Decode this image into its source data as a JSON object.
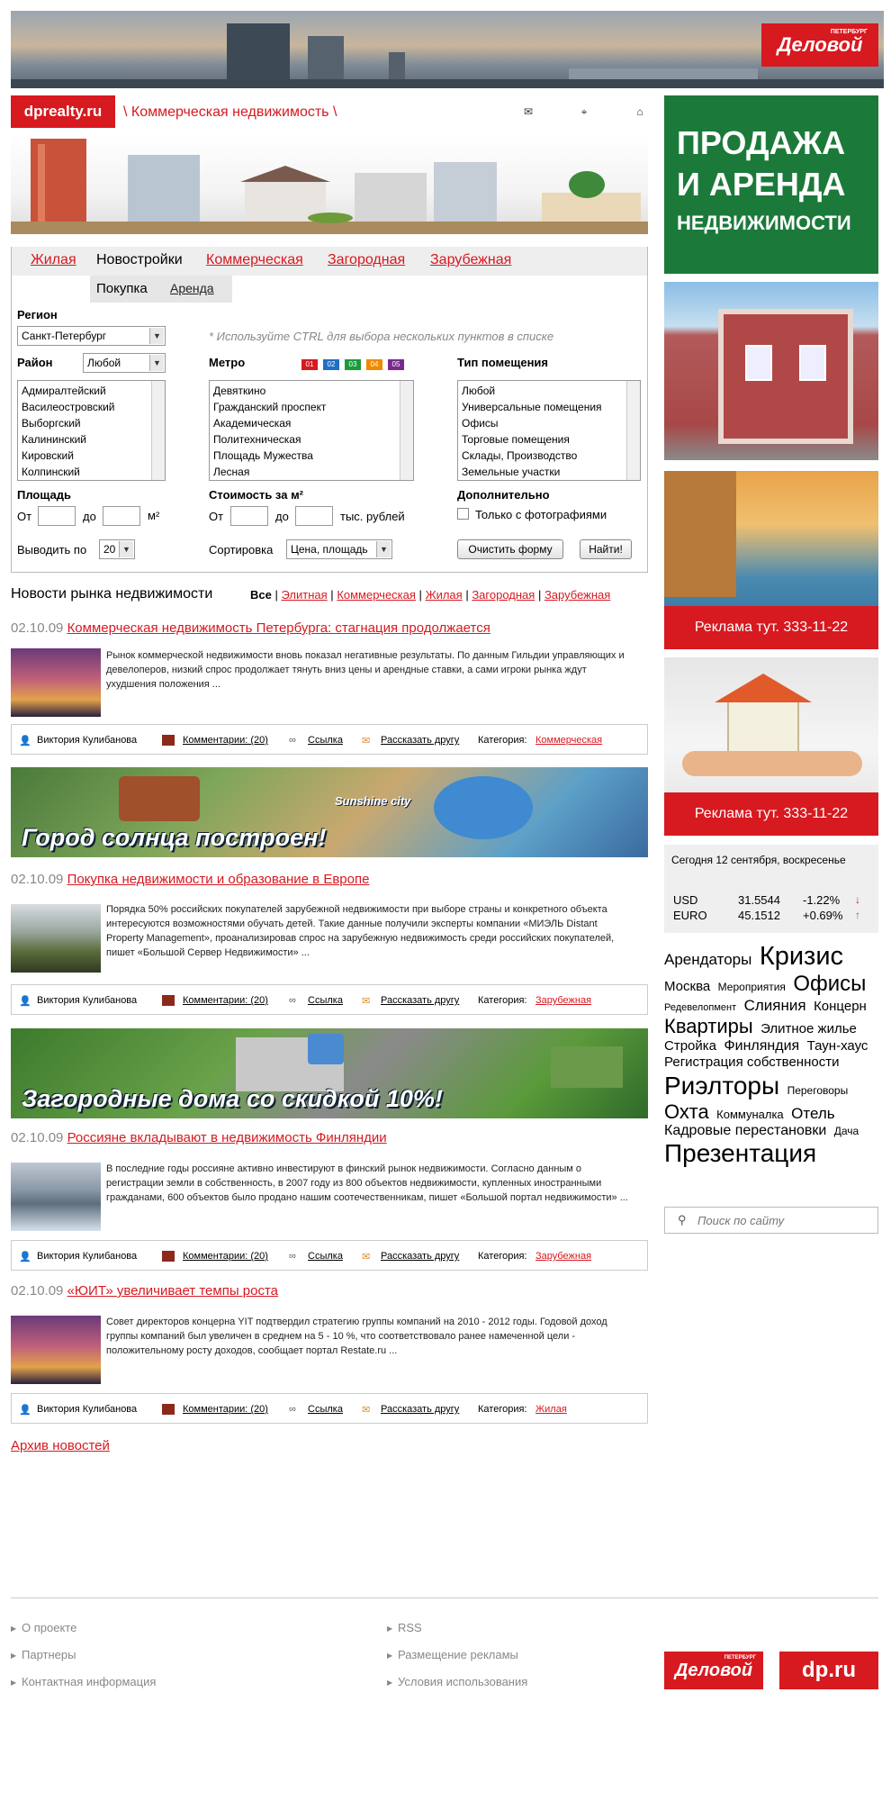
{
  "header": {
    "brand_top": "Деловой",
    "brand_top_small": "ПЕТЕРБУРГ",
    "site_logo": "dprealty.ru",
    "section_title": "\\ Коммерческая недвижимость \\",
    "icons": [
      "mail-icon",
      "sitemap-icon",
      "home-icon"
    ]
  },
  "tabs": [
    "Жилая",
    "Новостройки",
    "Коммерческая",
    "Загородная",
    "Зарубежная"
  ],
  "active_tab": "Новостройки",
  "subtabs": [
    "Покупка",
    "Аренда"
  ],
  "form": {
    "region_label": "Регион",
    "region_value": "Санкт-Петербург",
    "hint": "* Используйте CTRL для выбора нескольких пунктов в списке",
    "district_label": "Район",
    "district_value": "Любой",
    "districts": [
      "Адмиралтейский",
      "Василеостровский",
      "Выборгский",
      "Калининский",
      "Кировский",
      "Колпинский"
    ],
    "metro_label": "Метро",
    "metro_lines": [
      {
        "label": "01",
        "color": "#d71920"
      },
      {
        "label": "02",
        "color": "#1f6fc5"
      },
      {
        "label": "03",
        "color": "#1b9b3a"
      },
      {
        "label": "04",
        "color": "#f08a00"
      },
      {
        "label": "05",
        "color": "#7a2a8f"
      }
    ],
    "metro": [
      "Девяткино",
      "Гражданский проспект",
      "Академическая",
      "Политехническая",
      "Площадь Мужества",
      "Лесная"
    ],
    "type_label": "Тип помещения",
    "types": [
      "Любой",
      "Универсальные помещения",
      "Офисы",
      "Торговые помещения",
      "Склады, Производство",
      "Земельные участки"
    ],
    "area_label": "Площадь",
    "from": "От",
    "to": "до",
    "area_unit": "м²",
    "price_label": "Стоимость за м²",
    "price_unit": "тыс. рублей",
    "extra_label": "Дополнительно",
    "photos_only": "Только с фотографиями",
    "per_page_label": "Выводить по",
    "per_page_value": "20",
    "sort_label": "Сортировка",
    "sort_value": "Цена, площадь",
    "clear_btn": "Очистить форму",
    "search_btn": "Найти!"
  },
  "news_section": {
    "title": "Новости рынка недвижимости",
    "filters": [
      "Все",
      "Элитная",
      "Коммерческая",
      "Жилая",
      "Загородная",
      "Зарубежная"
    ],
    "archive": "Архив новостей"
  },
  "news": [
    {
      "date": "02.10.09",
      "title": "Коммерческая недвижимость Петербурга: стагнация продолжается",
      "text": "Рынок коммерческой недвижимости вновь показал негативные результаты. По данным Гильдии управляющих и девелоперов, низкий спрос продолжает тянуть вниз цены и арендные ставки, а сами игроки рынка ждут ухудшения положения ...",
      "author": "Виктория Кулибанова",
      "comments": "Комментарии: (20)",
      "link": "Ссылка",
      "share": "Рассказать другу",
      "cat_label": "Категория:",
      "category": "Коммерческая"
    },
    {
      "date": "02.10.09",
      "title": "Покупка недвижимости и образование в Европе",
      "text": "Порядка 50% российских покупателей зарубежной недвижимости при выборе страны и конкретного объекта интересуются возможностями обучать детей. Такие данные получили эксперты компании «МИЭЛЬ Distant Property Management», проанализировав спрос на зарубежную недвижимость среди российских покупателей, пишет «Большой Сервер Недвижимости» ...",
      "author": "Виктория Кулибанова",
      "comments": "Комментарии: (20)",
      "link": "Ссылка",
      "share": "Рассказать другу",
      "cat_label": "Категория:",
      "category": "Зарубежная"
    },
    {
      "date": "02.10.09",
      "title": "Россияне вкладывают в недвижимость Финляндии",
      "text": "В последние годы россияне активно инвестируют в финский рынок недвижимости. Согласно данным о регистрации земли в собственность, в 2007 году из 800 объектов недвижимости, купленных иностранными гражданами, 600 объектов было продано нашим соотечественникам, пишет «Большой портал недвижимости» ...",
      "author": "Виктория Кулибанова",
      "comments": "Комментарии: (20)",
      "link": "Ссылка",
      "share": "Рассказать другу",
      "cat_label": "Категория:",
      "category": "Зарубежная"
    },
    {
      "date": "02.10.09",
      "title": "«ЮИТ» увеличивает темпы роста",
      "text": "Совет директоров концерна YIT подтвердил стратегию группы компаний на 2010 - 2012 годы. Годовой доход группы компаний был увеличен в среднем на 5 - 10 %, что соответствовало ранее намеченной цели - положительному росту доходов, сообщает портал Restate.ru ...",
      "author": "Виктория Кулибанова",
      "comments": "Комментарии: (20)",
      "link": "Ссылка",
      "share": "Рассказать другу",
      "cat_label": "Категория:",
      "category": "Жилая"
    }
  ],
  "promos": [
    {
      "text": "Город солнца построен!",
      "logo": "Sunshine city"
    },
    {
      "text": "Загородные дома со скидкой 10%!"
    }
  ],
  "sidebar": {
    "ad_main": [
      "ПРОДАЖА",
      "И АРЕНДА",
      "НЕДВИЖИМОСТИ"
    ],
    "ad_phone": "Реклама тут. 333-11-22",
    "date_line": "Сегодня 12 сентября, воскресенье",
    "currencies": [
      {
        "name": "USD",
        "rate": "31.5544",
        "change": "-1.22%",
        "dir": "down"
      },
      {
        "name": "EURO",
        "rate": "45.1512",
        "change": "+0.69%",
        "dir": "up"
      }
    ],
    "tags": [
      {
        "t": "Арендаторы",
        "s": 17
      },
      {
        "t": "Кризис",
        "s": 29
      },
      {
        "t": "Москва",
        "s": 15
      },
      {
        "t": "Мероприятия",
        "s": 12
      },
      {
        "t": "Офисы",
        "s": 24
      },
      {
        "t": "Редевелопмент",
        "s": 11
      },
      {
        "t": "Слияния",
        "s": 17
      },
      {
        "t": "Концерн",
        "s": 15
      },
      {
        "t": "Квартиры",
        "s": 22
      },
      {
        "t": "Элитное жилье",
        "s": 15
      },
      {
        "t": "Стройка",
        "s": 15
      },
      {
        "t": "Финляндия",
        "s": 16
      },
      {
        "t": "Таун-хаус",
        "s": 15
      },
      {
        "t": "Регистрация собственности",
        "s": 15
      },
      {
        "t": "Риэлторы",
        "s": 28
      },
      {
        "t": "Переговоры",
        "s": 12
      },
      {
        "t": "Охта",
        "s": 22
      },
      {
        "t": "Коммуналка",
        "s": 13
      },
      {
        "t": "Отель",
        "s": 17
      },
      {
        "t": "Кадровые перестановки",
        "s": 16
      },
      {
        "t": "Дача",
        "s": 12
      },
      {
        "t": "Презентация",
        "s": 28
      }
    ],
    "search_placeholder": "Поиск по сайту"
  },
  "footer": {
    "col1": [
      "О проекте",
      "Партнеры",
      "Контактная информация"
    ],
    "col2": [
      "RSS",
      "Размещение рекламы",
      "Условия использования"
    ],
    "logo1": "Деловой",
    "logo1_small": "ПЕТЕРБУРГ",
    "logo2": "dp.ru"
  }
}
